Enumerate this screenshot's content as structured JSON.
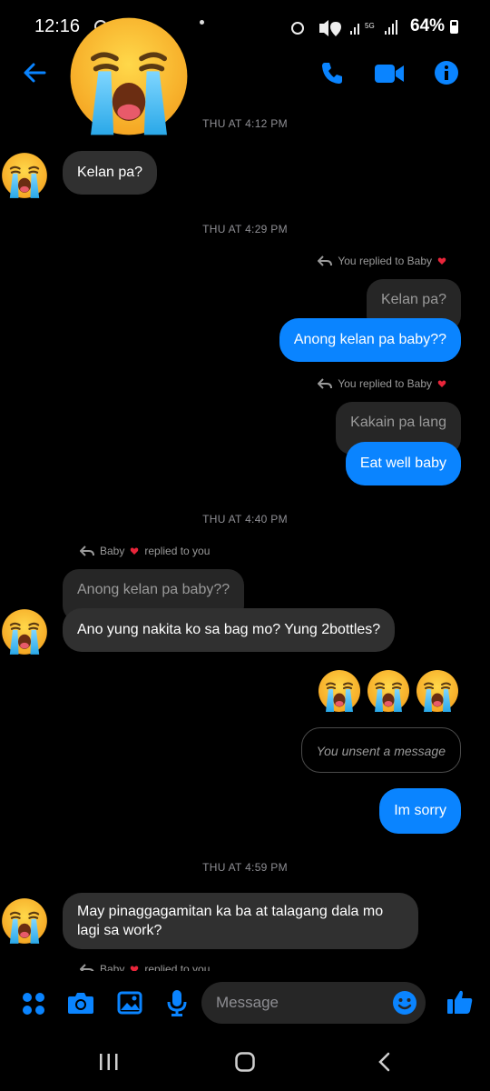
{
  "status_bar": {
    "time": "12:16",
    "battery": "64%",
    "network": "5G",
    "battery_level": 0.64
  },
  "header": {
    "contact_avatar": "loudly-crying-face-emoji"
  },
  "conversation": {
    "timestamps": [
      "THU AT 4:12 PM",
      "THU AT 4:29 PM",
      "THU AT 4:40 PM",
      "THU AT 4:59 PM"
    ],
    "messages": [
      {
        "from": "them",
        "text": "Kelan pa?"
      },
      {
        "from": "me",
        "reply_note": "You replied to Baby",
        "quoted": "Kelan pa?",
        "text": "Anong kelan pa baby??"
      },
      {
        "from": "me",
        "reply_note": "You replied to Baby",
        "quoted": "Kakain pa lang",
        "text": "Eat well baby"
      },
      {
        "from": "them",
        "reply_note_name": "Baby",
        "reply_note_suffix": "replied to you",
        "quoted": "Anong kelan pa baby??",
        "text": "Ano yung nakita ko sa bag mo? Yung 2bottles?"
      },
      {
        "from": "me",
        "text": "😭😭😭"
      },
      {
        "from": "me",
        "text": "You unsent a message"
      },
      {
        "from": "me",
        "text": "Im sorry"
      },
      {
        "from": "them",
        "text": "May pinaggagamitan ka ba at talagang dala mo lagi sa work?"
      },
      {
        "from": "them",
        "reply_note_name": "Baby",
        "reply_note_suffix": "replied to you"
      }
    ]
  },
  "composer": {
    "placeholder": "Message"
  },
  "colors": {
    "accent": "#0a84ff",
    "incoming_bubble": "#303030",
    "quoted_bubble": "#262626",
    "heart": "#e8253a"
  }
}
